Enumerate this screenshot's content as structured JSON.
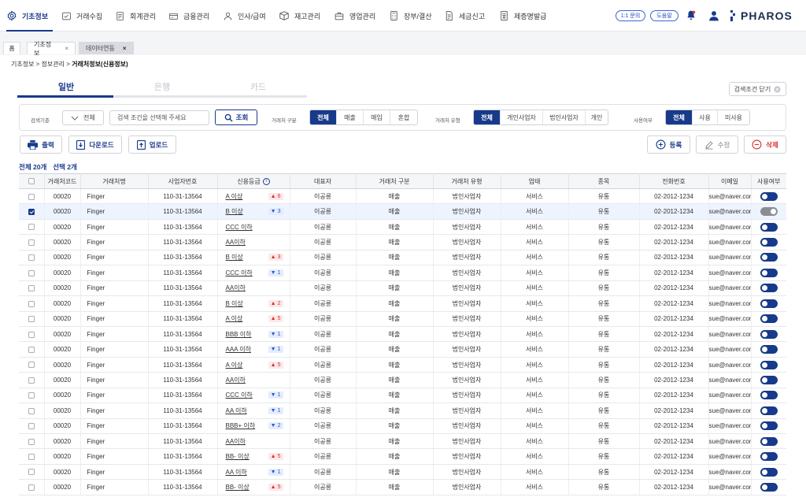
{
  "nav": {
    "items": [
      {
        "label": "기초정보",
        "icon": "gear-icon"
      },
      {
        "label": "거래수집",
        "icon": "collect-icon"
      },
      {
        "label": "회계관리",
        "icon": "ledger-icon"
      },
      {
        "label": "금융관리",
        "icon": "finance-icon"
      },
      {
        "label": "인사/급여",
        "icon": "people-icon"
      },
      {
        "label": "재고관리",
        "icon": "box-icon"
      },
      {
        "label": "영업관리",
        "icon": "briefcase-icon"
      },
      {
        "label": "장부/결산",
        "icon": "calculator-icon"
      },
      {
        "label": "세금신고",
        "icon": "tax-doc-icon"
      },
      {
        "label": "제증명발급",
        "icon": "certificate-icon"
      }
    ],
    "inquiry_label": "1:1 문의",
    "help_label": "도움말",
    "brand": "PHAROS"
  },
  "page_tabs": [
    {
      "label": "홈"
    },
    {
      "label": "기초정보",
      "close": "×"
    },
    {
      "label": "데이터연동",
      "close": "×"
    }
  ],
  "breadcrumb": {
    "path": "기초정보 > 정보관리 > ",
    "current": "거래처정보(신용정보)"
  },
  "sub_tabs": [
    "일반",
    "은행",
    "카드"
  ],
  "close_filter_label": "검색조건 닫기",
  "filter": {
    "search_label": "검색기준",
    "search_scope": "전체",
    "search_placeholder": "검색 조건을 선택해 주세요",
    "search_button": "조회",
    "partner_type_label": "거래처 구분",
    "partner_type_options": [
      "전체",
      "매출",
      "매입",
      "혼합"
    ],
    "partner_kind_label": "거래처 유형",
    "partner_kind_options": [
      "전체",
      "개인사업자",
      "법인사업자",
      "개인"
    ],
    "usage_label": "사용여부",
    "usage_options": [
      "전체",
      "사용",
      "미사용"
    ]
  },
  "actions": {
    "print": "출력",
    "download": "다운로드",
    "upload": "업로드",
    "register": "등록",
    "edit": "수정",
    "delete": "삭제"
  },
  "counts": {
    "total": "전체 20개",
    "selected": "선택 2개"
  },
  "table": {
    "headers": [
      "거래처코드",
      "거래처명",
      "사업자번호",
      "신용등급",
      "대표자",
      "거래처 구분",
      "거래처 유형",
      "업태",
      "종목",
      "전화번호",
      "이메일",
      "사용여부"
    ],
    "rows": [
      {
        "code": "00020",
        "name": "Finger",
        "bizno": "110-31-13564",
        "grade": "A 이상",
        "dir": "up",
        "delta": "6",
        "rep": "이공릉",
        "type": "매출",
        "kind": "법인사업자",
        "biz": "서비스",
        "item": "유통",
        "tel": "02-2012-1234",
        "email": "sue@naver.com",
        "use": true,
        "checked": false
      },
      {
        "code": "00020",
        "name": "Finger",
        "bizno": "110-31-13564",
        "grade": "B 이상",
        "dir": "down",
        "delta": "3",
        "rep": "이공릉",
        "type": "매출",
        "kind": "법인사업자",
        "biz": "서비스",
        "item": "유통",
        "tel": "02-2012-1234",
        "email": "sue@naver.com",
        "use": false,
        "checked": true
      },
      {
        "code": "00020",
        "name": "Finger",
        "bizno": "110-31-13564",
        "grade": "CCC 이하",
        "dir": "",
        "delta": "",
        "rep": "이공릉",
        "type": "매출",
        "kind": "법인사업자",
        "biz": "서비스",
        "item": "유통",
        "tel": "02-2012-1234",
        "email": "sue@naver.com",
        "use": true,
        "checked": false
      },
      {
        "code": "00020",
        "name": "Finger",
        "bizno": "110-31-13564",
        "grade": "AA이하",
        "dir": "",
        "delta": "",
        "rep": "이공릉",
        "type": "매출",
        "kind": "법인사업자",
        "biz": "서비스",
        "item": "유통",
        "tel": "02-2012-1234",
        "email": "sue@naver.com",
        "use": true,
        "checked": false
      },
      {
        "code": "00020",
        "name": "Finger",
        "bizno": "110-31-13564",
        "grade": "B 이상",
        "dir": "up",
        "delta": "3",
        "rep": "이공릉",
        "type": "매출",
        "kind": "법인사업자",
        "biz": "서비스",
        "item": "유통",
        "tel": "02-2012-1234",
        "email": "sue@naver.com",
        "use": true,
        "checked": false
      },
      {
        "code": "00020",
        "name": "Finger",
        "bizno": "110-31-13564",
        "grade": "CCC 이하",
        "dir": "down",
        "delta": "1",
        "rep": "이공릉",
        "type": "매출",
        "kind": "법인사업자",
        "biz": "서비스",
        "item": "유통",
        "tel": "02-2012-1234",
        "email": "sue@naver.com",
        "use": true,
        "checked": false
      },
      {
        "code": "00020",
        "name": "Finger",
        "bizno": "110-31-13564",
        "grade": "AA이하",
        "dir": "",
        "delta": "",
        "rep": "이공릉",
        "type": "매출",
        "kind": "법인사업자",
        "biz": "서비스",
        "item": "유통",
        "tel": "02-2012-1234",
        "email": "sue@naver.com",
        "use": true,
        "checked": false
      },
      {
        "code": "00020",
        "name": "Finger",
        "bizno": "110-31-13564",
        "grade": "B 이상",
        "dir": "up",
        "delta": "2",
        "rep": "이공릉",
        "type": "매출",
        "kind": "법인사업자",
        "biz": "서비스",
        "item": "유통",
        "tel": "02-2012-1234",
        "email": "sue@naver.com",
        "use": true,
        "checked": false
      },
      {
        "code": "00020",
        "name": "Finger",
        "bizno": "110-31-13564",
        "grade": "A 이상",
        "dir": "up",
        "delta": "5",
        "rep": "이공릉",
        "type": "매출",
        "kind": "법인사업자",
        "biz": "서비스",
        "item": "유통",
        "tel": "02-2012-1234",
        "email": "sue@naver.com",
        "use": true,
        "checked": false
      },
      {
        "code": "00020",
        "name": "Finger",
        "bizno": "110-31-13564",
        "grade": "BBB 이하",
        "dir": "down",
        "delta": "1",
        "rep": "이공릉",
        "type": "매출",
        "kind": "법인사업자",
        "biz": "서비스",
        "item": "유통",
        "tel": "02-2012-1234",
        "email": "sue@naver.com",
        "use": true,
        "checked": false
      },
      {
        "code": "00020",
        "name": "Finger",
        "bizno": "110-31-13564",
        "grade": "AAA 이하",
        "dir": "down",
        "delta": "1",
        "rep": "이공릉",
        "type": "매출",
        "kind": "법인사업자",
        "biz": "서비스",
        "item": "유통",
        "tel": "02-2012-1234",
        "email": "sue@naver.com",
        "use": true,
        "checked": false
      },
      {
        "code": "00020",
        "name": "Finger",
        "bizno": "110-31-13564",
        "grade": "A 이상",
        "dir": "up",
        "delta": "5",
        "rep": "이공릉",
        "type": "매출",
        "kind": "법인사업자",
        "biz": "서비스",
        "item": "유통",
        "tel": "02-2012-1234",
        "email": "sue@naver.com",
        "use": true,
        "checked": false
      },
      {
        "code": "00020",
        "name": "Finger",
        "bizno": "110-31-13564",
        "grade": "AA이하",
        "dir": "",
        "delta": "",
        "rep": "이공릉",
        "type": "매출",
        "kind": "법인사업자",
        "biz": "서비스",
        "item": "유통",
        "tel": "02-2012-1234",
        "email": "sue@naver.com",
        "use": true,
        "checked": false
      },
      {
        "code": "00020",
        "name": "Finger",
        "bizno": "110-31-13564",
        "grade": "CCC 이하",
        "dir": "down",
        "delta": "1",
        "rep": "이공릉",
        "type": "매출",
        "kind": "법인사업자",
        "biz": "서비스",
        "item": "유통",
        "tel": "02-2012-1234",
        "email": "sue@naver.com",
        "use": true,
        "checked": false
      },
      {
        "code": "00020",
        "name": "Finger",
        "bizno": "110-31-13564",
        "grade": "AA 이하",
        "dir": "down",
        "delta": "1",
        "rep": "이공릉",
        "type": "매출",
        "kind": "법인사업자",
        "biz": "서비스",
        "item": "유통",
        "tel": "02-2012-1234",
        "email": "sue@naver.com",
        "use": true,
        "checked": false
      },
      {
        "code": "00020",
        "name": "Finger",
        "bizno": "110-31-13564",
        "grade": "BBB+ 이하",
        "dir": "down",
        "delta": "2",
        "rep": "이공릉",
        "type": "매출",
        "kind": "법인사업자",
        "biz": "서비스",
        "item": "유통",
        "tel": "02-2012-1234",
        "email": "sue@naver.com",
        "use": true,
        "checked": false
      },
      {
        "code": "00020",
        "name": "Finger",
        "bizno": "110-31-13564",
        "grade": "AA이하",
        "dir": "",
        "delta": "",
        "rep": "이공릉",
        "type": "매출",
        "kind": "법인사업자",
        "biz": "서비스",
        "item": "유통",
        "tel": "02-2012-1234",
        "email": "sue@naver.com",
        "use": true,
        "checked": false
      },
      {
        "code": "00020",
        "name": "Finger",
        "bizno": "110-31-13564",
        "grade": "BB- 이상",
        "dir": "up",
        "delta": "5",
        "rep": "이공릉",
        "type": "매출",
        "kind": "법인사업자",
        "biz": "서비스",
        "item": "유통",
        "tel": "02-2012-1234",
        "email": "sue@naver.com",
        "use": true,
        "checked": false
      },
      {
        "code": "00020",
        "name": "Finger",
        "bizno": "110-31-13564",
        "grade": "AA 이하",
        "dir": "down",
        "delta": "1",
        "rep": "이공릉",
        "type": "매출",
        "kind": "법인사업자",
        "biz": "서비스",
        "item": "유통",
        "tel": "02-2012-1234",
        "email": "sue@naver.com",
        "use": true,
        "checked": false
      },
      {
        "code": "00020",
        "name": "Finger",
        "bizno": "110-31-13564",
        "grade": "BB- 이상",
        "dir": "up",
        "delta": "5",
        "rep": "이공릉",
        "type": "매출",
        "kind": "법인사업자",
        "biz": "서비스",
        "item": "유통",
        "tel": "02-2012-1234",
        "email": "sue@naver.com",
        "use": true,
        "checked": false
      }
    ]
  },
  "colors": {
    "primary": "#173a8a",
    "up": "#d93030",
    "down": "#2b55d9"
  }
}
